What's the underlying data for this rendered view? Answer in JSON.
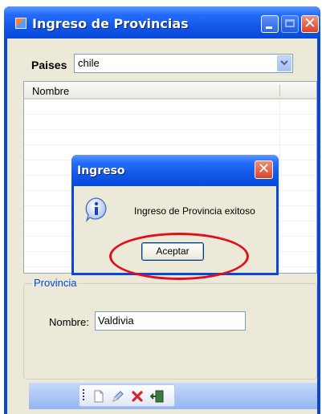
{
  "window": {
    "title": "Ingreso de Provincias",
    "accent": "#0a47d6"
  },
  "form": {
    "paises_label": "Paises",
    "paises_value": "chile",
    "grid": {
      "columns": [
        "Nombre"
      ],
      "rows": []
    },
    "groupbox_label": "Provincia",
    "nombre_label": "Nombre:",
    "nombre_value": "Valdivia"
  },
  "toolbar": {
    "icons": [
      "new-document-icon",
      "edit-pencil-icon",
      "delete-x-icon",
      "exit-door-icon"
    ]
  },
  "dialog": {
    "title": "Ingreso",
    "message": "Ingreso de Provincia exitoso",
    "ok_label": "Aceptar",
    "icon": "info-icon"
  },
  "annotation": {
    "highlight_color": "#e10f1c"
  }
}
